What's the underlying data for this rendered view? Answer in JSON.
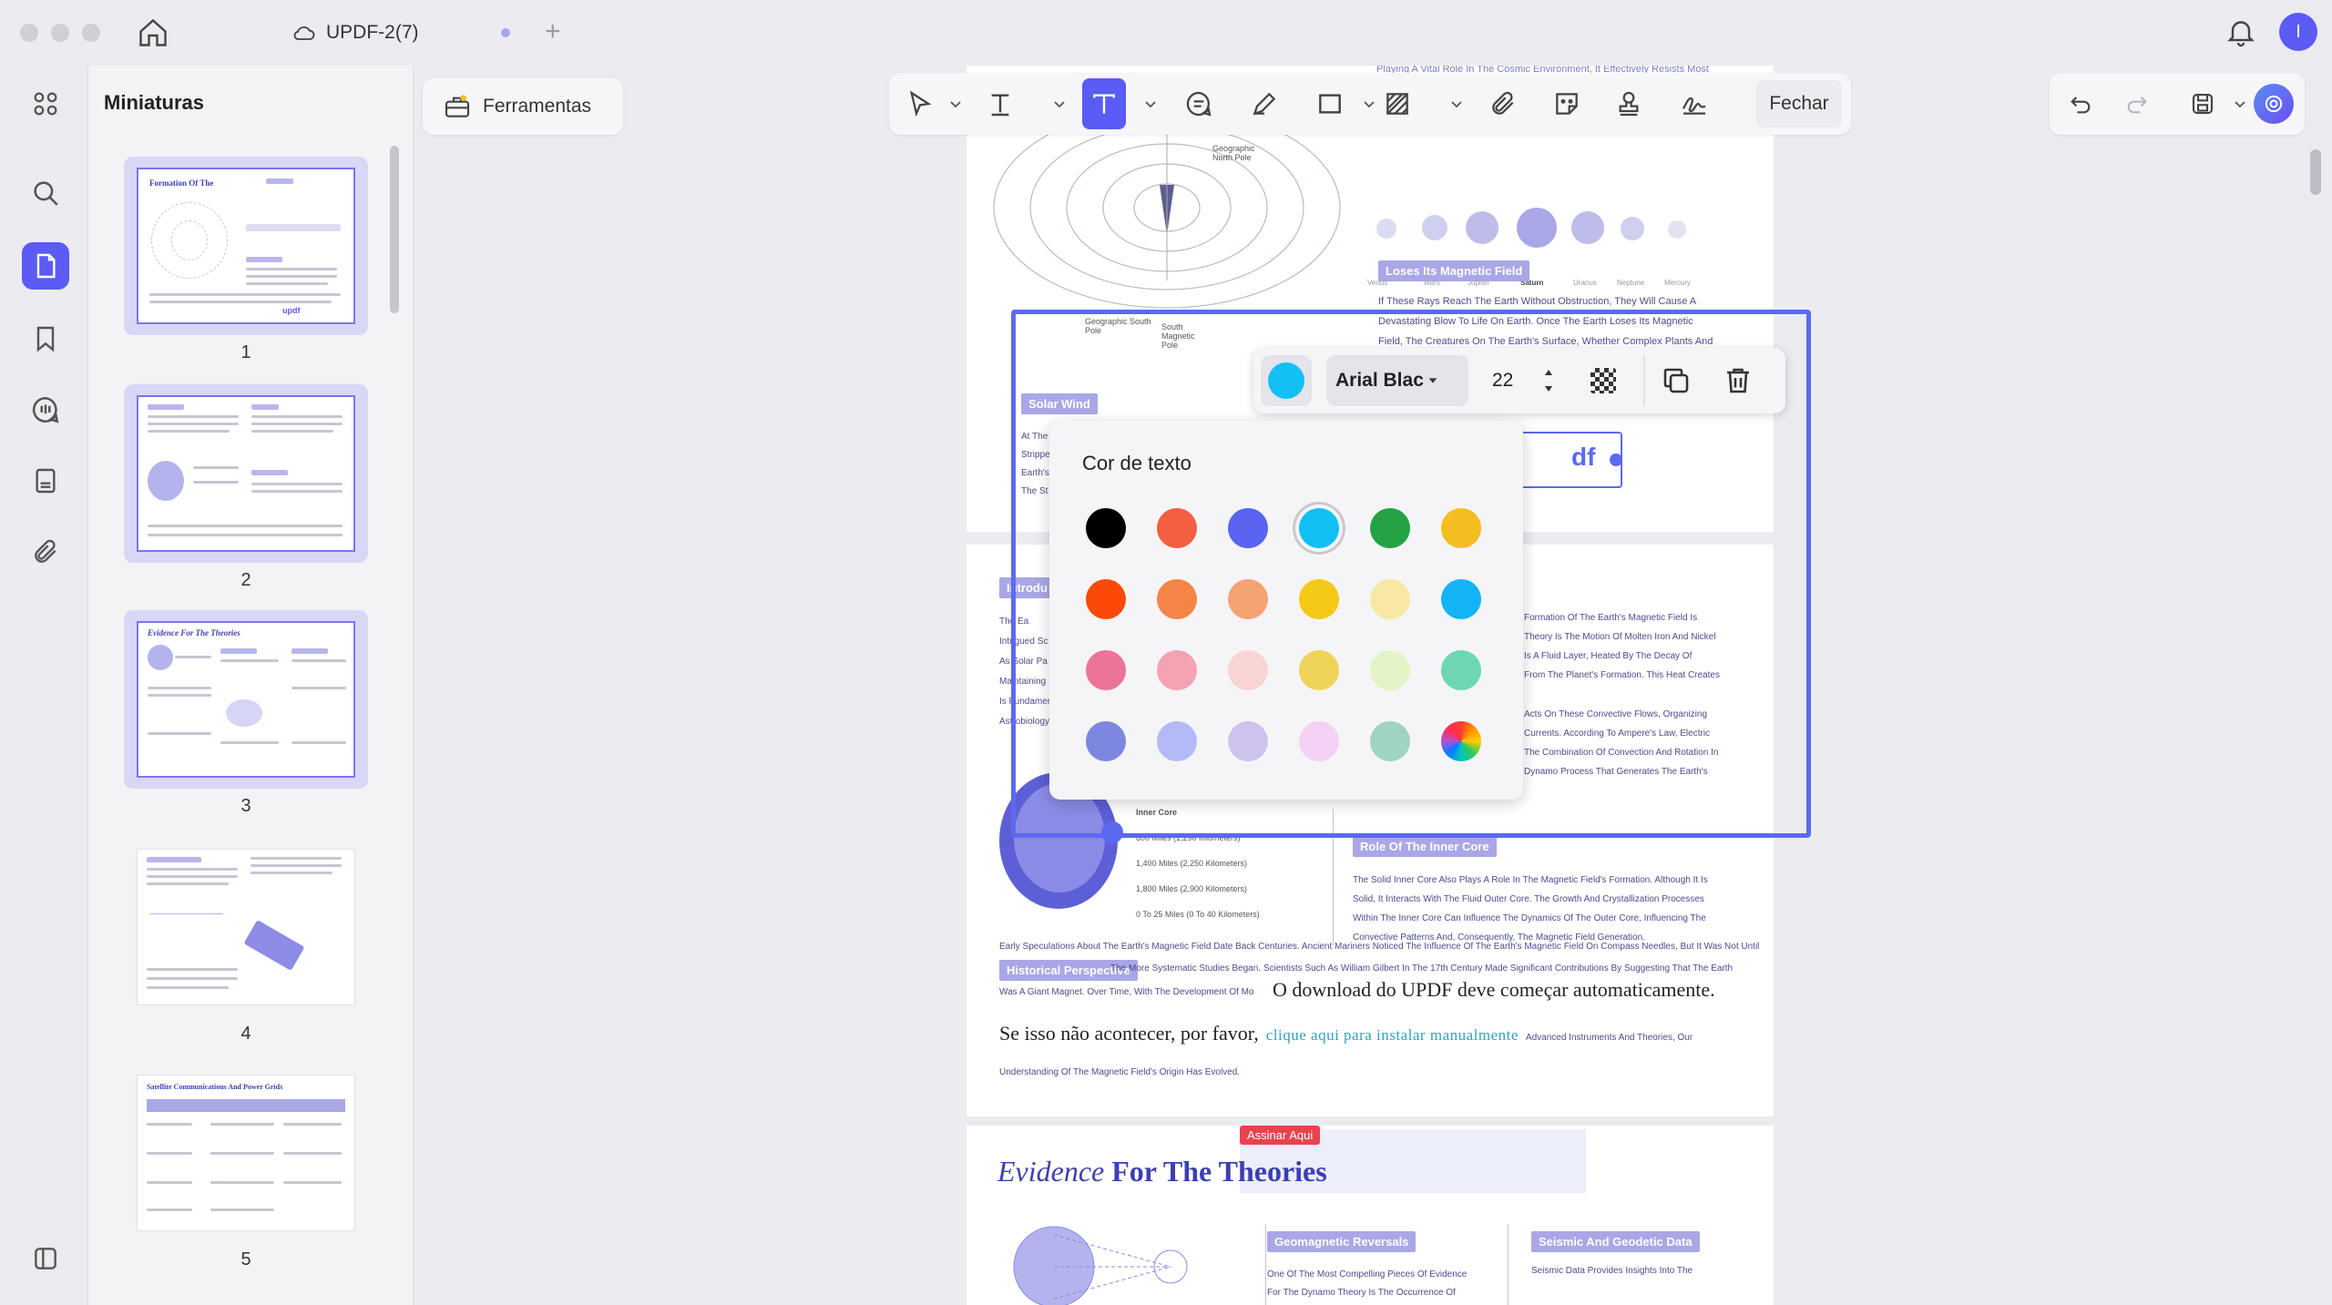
{
  "window": {
    "tab_title": "UPDF-2(7)",
    "avatar_letter": "I"
  },
  "sidebar": {
    "title": "Miniaturas"
  },
  "thumbnails": [
    {
      "num": "1",
      "title": "Formation Of The"
    },
    {
      "num": "2",
      "title": ""
    },
    {
      "num": "3",
      "title": "Evidence For The Theories"
    },
    {
      "num": "4",
      "title": ""
    },
    {
      "num": "5",
      "title": "Satellite Communications And Power Grids"
    }
  ],
  "toolbar": {
    "tools_label": "Ferramentas",
    "close_label": "Fechar"
  },
  "format_bar": {
    "font_name": "Arial Blac",
    "font_size": "22",
    "current_color": "#12c0f5"
  },
  "color_panel": {
    "title": "Cor de texto",
    "colors": [
      [
        "#000000",
        "#f2603f",
        "#5a63f2",
        "#12c0f5",
        "#25a244",
        "#f4bd20"
      ],
      [
        "#fb4a07",
        "#f58447",
        "#f6a374",
        "#f5c918",
        "#f8e8a4",
        "#12b4f5"
      ],
      [
        "#ec7499",
        "#f5a2b2",
        "#f8d4d2",
        "#f0d45a",
        "#e4f4c8",
        "#6dd7b4"
      ],
      [
        "#7d87e0",
        "#b4baf6",
        "#cec3ef",
        "#f3d2f5",
        "#9fd3c3",
        "rainbow"
      ]
    ],
    "selected": "#12c0f5"
  },
  "document": {
    "planet_labels": [
      "Venus",
      "Mars",
      "Jupiter",
      "Saturn",
      "Uranus",
      "Neptune",
      "Mercury"
    ],
    "pole_labels": {
      "geo_north": "Geographic North Pole",
      "geo_south": "Geographic South Pole",
      "mag_south": "South Magnetic Pole"
    },
    "pills": {
      "loses": "Loses Its Magnetic Field",
      "solar": "Solar Wind",
      "intro": "Introdu",
      "inner_core_role": "Role Of The Inner Core",
      "historical": "Historical Perspective",
      "geo_reversal": "Geomagnetic Reversals",
      "seismic": "Seismic And Geodetic Data"
    },
    "top_line": "Playing A Vital Role In The Cosmic Environment, It Effectively Resists Most",
    "loses_text": [
      "If These Rays Reach The Earth Without Obstruction, They Will Cause A",
      "Devastating Blow To Life On Earth. Once The Earth Loses Its Magnetic",
      "Field, The Creatures On The Earth's Surface, Whether Complex Plants And"
    ],
    "solar_left": [
      "At The",
      "Strippe",
      "Earth's",
      "The St"
    ],
    "intro_left": [
      "The Ea",
      "Intrigued Sc",
      "As Solar Pa",
      "Maintaining",
      "Is Fundamen",
      "Astrobiology"
    ],
    "intro_right": [
      "Formation Of The Earth's Magnetic Field Is",
      "Theory Is The Motion Of Molten Iron And Nickel",
      "Is A Fluid Layer, Heated By The Decay Of",
      "From The Planet's Formation. This Heat Creates",
      "Acts On These Convective Flows, Organizing",
      "Currents. According To Ampere's Law, Electric",
      "The Combination Of Convection And Rotation In",
      "Dynamo Process That Generates The Earth's"
    ],
    "core_labels": [
      "Inner Core",
      "800 Miles (1,290 Kilometers)",
      "1,400 Miles (2,250 Kilometers)",
      "1,800 Miles (2,900 Kilometers)",
      "0 To 25 Miles (0 To 40 Kilometers)"
    ],
    "inner_core_text": [
      "The Solid Inner Core Also Plays A Role In The Magnetic Field's Formation. Although It Is",
      "Solid, It Interacts With The Fluid Outer Core. The Growth And Crystallization Processes",
      "Within The Inner Core Can Influence The Dynamics Of The Outer Core, Influencing The",
      "Convective Patterns And, Consequently, The Magnetic Field Generation."
    ],
    "early_line": "Early Speculations About The Earth's Magnetic Field Date Back Centuries. Ancient Mariners Noticed The Influence Of The Earth's Magnetic Field On Compass Needles, But It Was Not Until",
    "hist_frag1": "The More Systematic Studies Began. Scientists Such As William Gilbert In The 17th Century Made Significant Contributions By Suggesting That The Earth",
    "hist_frag2": "Was A Giant Magnet. Over Time, With The Development Of Mo",
    "download_line": "O download do UPDF deve começar automaticamente.",
    "fallback_prefix": "Se isso não acontecer, por favor,",
    "fallback_link": "clique aqui para instalar manualmente",
    "fallback_suffix": "Advanced Instruments And Theories, Our",
    "understanding_line": "Understanding Of The Magnetic Field's Origin Has Evolved.",
    "sign_badge": "Assinar Aqui",
    "evidence_italic": "Evidence",
    "evidence_bold": "For The Theories",
    "geo_text": [
      "One Of The Most Compelling Pieces Of Evidence",
      "For The Dynamo Theory Is The Occurrence Of"
    ],
    "seismic_text": [
      "Seismic Data Provides Insights Into The"
    ],
    "selected_text_fragment": "df"
  }
}
